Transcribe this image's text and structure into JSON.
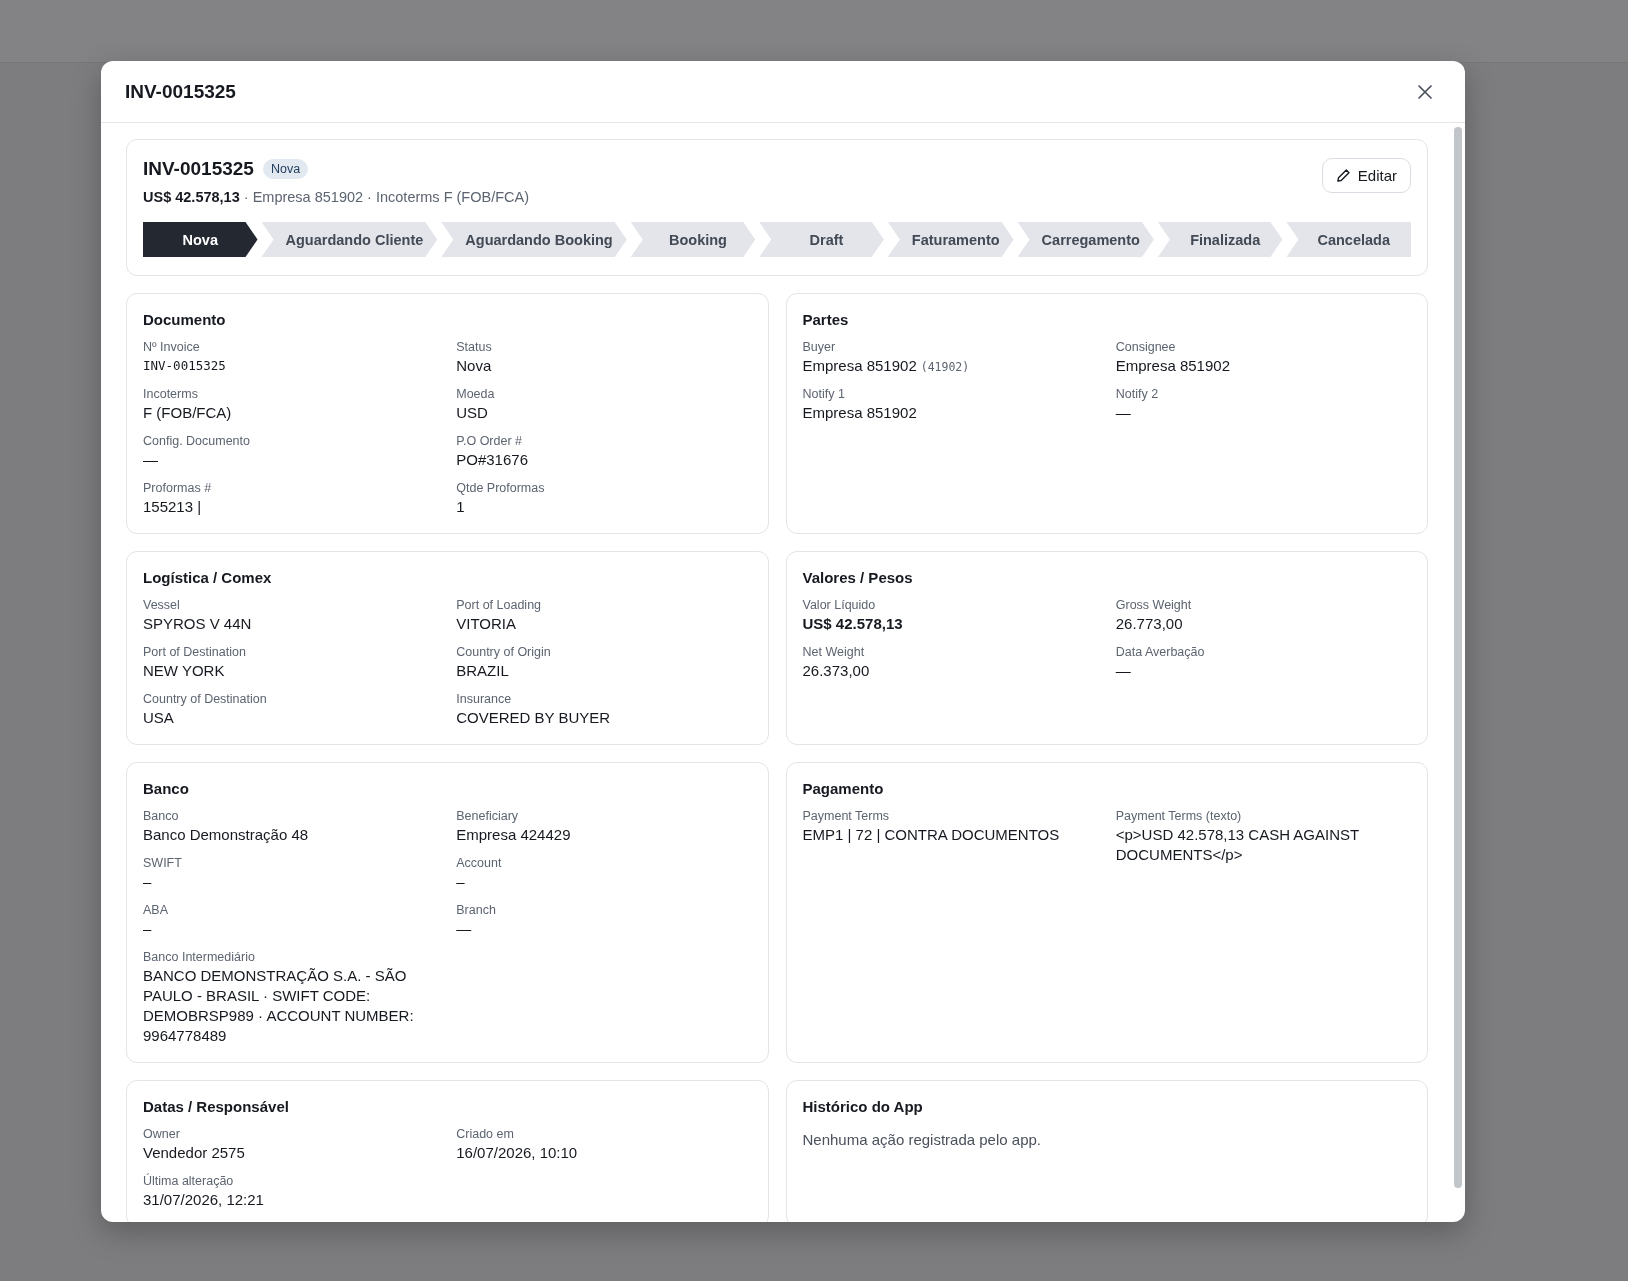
{
  "modal": {
    "title": "INV-0015325"
  },
  "summary": {
    "title": "INV-0015325",
    "status_badge": "Nova",
    "amount": "US$ 42.578,13",
    "details": " · Empresa 851902 · Incoterms F (FOB/FCA)",
    "edit_button": "Editar"
  },
  "stages": [
    {
      "label": "Nova",
      "selected": true
    },
    {
      "label": "Aguardando Cliente",
      "selected": false
    },
    {
      "label": "Aguardando Booking",
      "selected": false
    },
    {
      "label": "Booking",
      "selected": false
    },
    {
      "label": "Draft",
      "selected": false
    },
    {
      "label": "Faturamento",
      "selected": false
    },
    {
      "label": "Carregamento",
      "selected": false
    },
    {
      "label": "Finalizada",
      "selected": false
    },
    {
      "label": "Cancelada",
      "selected": false
    }
  ],
  "sections": [
    {
      "title": "Documento",
      "kind": "fields",
      "fields": [
        {
          "label": "Nº Invoice",
          "value": "INV-0015325",
          "kind": "mono"
        },
        {
          "label": "Status",
          "value": "Nova",
          "kind": "text"
        },
        {
          "label": "Incoterms",
          "value": "F (FOB/FCA)",
          "kind": "text"
        },
        {
          "label": "Moeda",
          "value": "USD",
          "kind": "text"
        },
        {
          "label": "Config. Documento",
          "value": "—",
          "kind": "text"
        },
        {
          "label": "P.O Order #",
          "value": "PO#31676",
          "kind": "text"
        },
        {
          "label": "Proformas #",
          "value": "155213 |",
          "kind": "text"
        },
        {
          "label": "Qtde Proformas",
          "value": "1",
          "kind": "text"
        }
      ]
    },
    {
      "title": "Partes",
      "kind": "fields",
      "fields": [
        {
          "label": "Buyer",
          "value": "Empresa 851902",
          "code": "(41902)",
          "kind": "coded"
        },
        {
          "label": "Consignee",
          "value": "Empresa 851902",
          "kind": "text"
        },
        {
          "label": "Notify 1",
          "value": "Empresa 851902",
          "kind": "text"
        },
        {
          "label": "Notify 2",
          "value": "—",
          "kind": "text"
        }
      ]
    },
    {
      "title": "Logística / Comex",
      "kind": "fields",
      "fields": [
        {
          "label": "Vessel",
          "value": "SPYROS V 44N",
          "kind": "text"
        },
        {
          "label": "Port of Loading",
          "value": "VITORIA",
          "kind": "text"
        },
        {
          "label": "Port of Destination",
          "value": "NEW YORK",
          "kind": "text"
        },
        {
          "label": "Country of Origin",
          "value": "BRAZIL",
          "kind": "text"
        },
        {
          "label": "Country of Destination",
          "value": "USA",
          "kind": "text"
        },
        {
          "label": "Insurance",
          "value": "COVERED BY BUYER",
          "kind": "text"
        }
      ]
    },
    {
      "title": "Valores / Pesos",
      "kind": "fields",
      "fields": [
        {
          "label": "Valor Líquido",
          "value": "US$ 42.578,13",
          "kind": "strong"
        },
        {
          "label": "Gross Weight",
          "value": "26.773,00",
          "kind": "text"
        },
        {
          "label": "Net Weight",
          "value": "26.373,00",
          "kind": "text"
        },
        {
          "label": "Data Averbação",
          "value": "—",
          "kind": "text"
        }
      ]
    },
    {
      "title": "Banco",
      "kind": "fields",
      "fields": [
        {
          "label": "Banco",
          "value": "Banco Demonstração 48",
          "kind": "text"
        },
        {
          "label": "Beneficiary",
          "value": "Empresa 424429",
          "kind": "text"
        },
        {
          "label": "SWIFT",
          "value": "–",
          "kind": "text"
        },
        {
          "label": "Account",
          "value": "–",
          "kind": "text"
        },
        {
          "label": "ABA",
          "value": "–",
          "kind": "text"
        },
        {
          "label": "Branch",
          "value": "—",
          "kind": "text"
        },
        {
          "label": "Banco Intermediário",
          "value": "BANCO DEMONSTRAÇÃO S.A. - SÃO PAULO - BRASIL · SWIFT CODE: DEMOBRSP989 · ACCOUNT NUMBER: 9964778489",
          "kind": "text"
        }
      ]
    },
    {
      "title": "Pagamento",
      "kind": "fields",
      "fields": [
        {
          "label": "Payment Terms",
          "value": "EMP1 | 72 | CONTRA DOCUMENTOS",
          "kind": "text"
        },
        {
          "label": "Payment Terms (texto)",
          "value": "<p>USD 42.578,13 CASH AGAINST DOCUMENTS</p>",
          "kind": "text"
        }
      ]
    },
    {
      "title": "Datas / Responsável",
      "kind": "fields",
      "fields": [
        {
          "label": "Owner",
          "value": "Vendedor 2575",
          "kind": "text"
        },
        {
          "label": "Criado em",
          "value": "16/07/2026, 10:10",
          "kind": "text"
        },
        {
          "label": "Última alteração",
          "value": "31/07/2026, 12:21",
          "kind": "text"
        }
      ]
    },
    {
      "title": "Histórico do App",
      "kind": "note",
      "note": "Nenhuma ação registrada pelo app."
    }
  ]
}
